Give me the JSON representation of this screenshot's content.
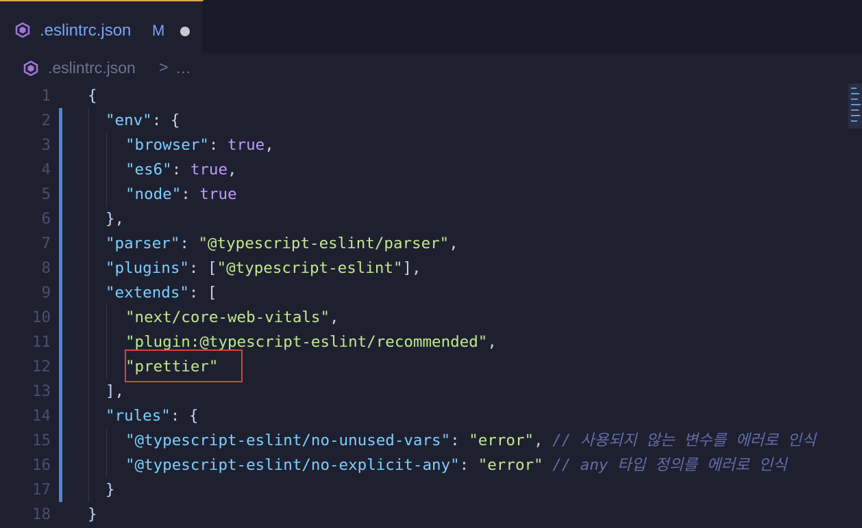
{
  "tab": {
    "filename": ".eslintrc.json",
    "status": "M",
    "icon": "eslint-icon"
  },
  "breadcrumb": {
    "file": ".eslintrc.json",
    "separator": ">",
    "more": "…"
  },
  "colors": {
    "key": "#7dcfff",
    "string": "#c3e88d",
    "boolean": "#c099ff",
    "punct": "#c8d3f5",
    "comment": "#636da6",
    "highlight_box": "#d9453a",
    "modified_gutter": "#4e86d8",
    "tab_accent": "#e0a44e"
  },
  "lines": [
    {
      "n": "1",
      "tokens": [
        [
          "p",
          "{"
        ]
      ],
      "indent": 0
    },
    {
      "n": "2",
      "tokens": [
        [
          "k",
          "\"env\""
        ],
        [
          "p",
          ": {"
        ]
      ],
      "indent": 1
    },
    {
      "n": "3",
      "tokens": [
        [
          "k",
          "\"browser\""
        ],
        [
          "p",
          ": "
        ],
        [
          "b",
          "true"
        ],
        [
          "p",
          ","
        ]
      ],
      "indent": 2
    },
    {
      "n": "4",
      "tokens": [
        [
          "k",
          "\"es6\""
        ],
        [
          "p",
          ": "
        ],
        [
          "b",
          "true"
        ],
        [
          "p",
          ","
        ]
      ],
      "indent": 2
    },
    {
      "n": "5",
      "tokens": [
        [
          "k",
          "\"node\""
        ],
        [
          "p",
          ": "
        ],
        [
          "b",
          "true"
        ]
      ],
      "indent": 2
    },
    {
      "n": "6",
      "tokens": [
        [
          "p",
          "},"
        ]
      ],
      "indent": 1
    },
    {
      "n": "7",
      "tokens": [
        [
          "k",
          "\"parser\""
        ],
        [
          "p",
          ": "
        ],
        [
          "s",
          "\"@typescript-eslint/parser\""
        ],
        [
          "p",
          ","
        ]
      ],
      "indent": 1
    },
    {
      "n": "8",
      "tokens": [
        [
          "k",
          "\"plugins\""
        ],
        [
          "p",
          ": ["
        ],
        [
          "s",
          "\"@typescript-eslint\""
        ],
        [
          "p",
          "],"
        ]
      ],
      "indent": 1
    },
    {
      "n": "9",
      "tokens": [
        [
          "k",
          "\"extends\""
        ],
        [
          "p",
          ": ["
        ]
      ],
      "indent": 1
    },
    {
      "n": "10",
      "tokens": [
        [
          "s",
          "\"next/core-web-vitals\""
        ],
        [
          "p",
          ","
        ]
      ],
      "indent": 2
    },
    {
      "n": "11",
      "tokens": [
        [
          "s",
          "\"plugin:@typescript-eslint/recommended\""
        ],
        [
          "p",
          ","
        ]
      ],
      "indent": 2
    },
    {
      "n": "12",
      "tokens": [
        [
          "s",
          "\"prettier\""
        ]
      ],
      "indent": 2
    },
    {
      "n": "13",
      "tokens": [
        [
          "p",
          "],"
        ]
      ],
      "indent": 1
    },
    {
      "n": "14",
      "tokens": [
        [
          "k",
          "\"rules\""
        ],
        [
          "p",
          ": {"
        ]
      ],
      "indent": 1
    },
    {
      "n": "15",
      "tokens": [
        [
          "k",
          "\"@typescript-eslint/no-unused-vars\""
        ],
        [
          "p",
          ": "
        ],
        [
          "s",
          "\"error\""
        ],
        [
          "p",
          ", "
        ],
        [
          "c",
          "// 사용되지 않는 변수를 에러로 인식"
        ]
      ],
      "indent": 2
    },
    {
      "n": "16",
      "tokens": [
        [
          "k",
          "\"@typescript-eslint/no-explicit-any\""
        ],
        [
          "p",
          ": "
        ],
        [
          "s",
          "\"error\""
        ],
        [
          "p",
          " "
        ],
        [
          "c",
          "// any 타입 정의를 에러로 인식"
        ]
      ],
      "indent": 2
    },
    {
      "n": "17",
      "tokens": [
        [
          "p",
          "}"
        ]
      ],
      "indent": 1
    },
    {
      "n": "18",
      "tokens": [
        [
          "p",
          "}"
        ]
      ],
      "indent": 0
    }
  ]
}
